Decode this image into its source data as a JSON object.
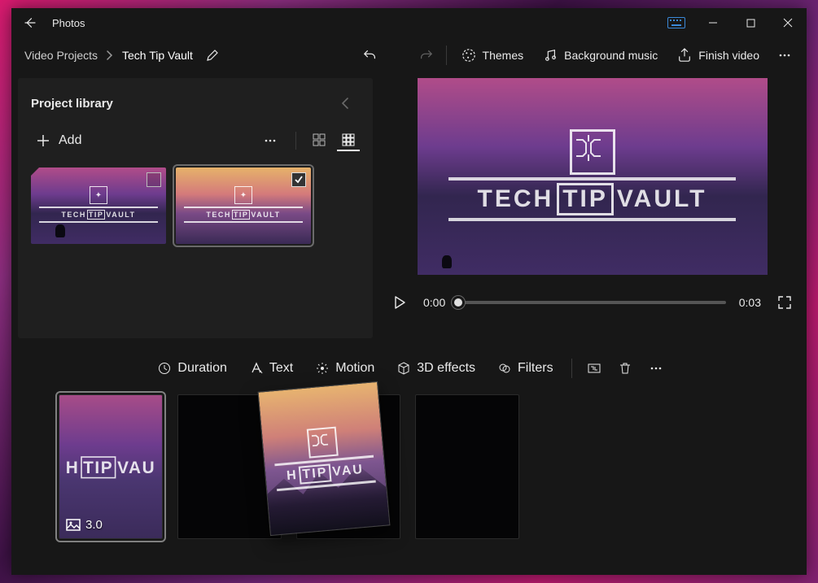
{
  "app": {
    "title": "Photos"
  },
  "breadcrumb": {
    "root": "Video Projects",
    "current": "Tech Tip Vault"
  },
  "toolbar": {
    "themes": "Themes",
    "bgmusic": "Background music",
    "finish": "Finish video"
  },
  "library": {
    "title": "Project library",
    "add": "Add",
    "items": [
      {
        "id": "night-thumb",
        "scene": "night",
        "selected": false
      },
      {
        "id": "sunset-thumb",
        "scene": "sunset",
        "selected": true
      }
    ]
  },
  "player": {
    "current": "0:00",
    "total": "0:03",
    "pos": 0
  },
  "cliptoolbar": {
    "duration": "Duration",
    "text": "Text",
    "motion": "Motion",
    "3deffects": "3D effects",
    "filters": "Filters"
  },
  "storyboard": {
    "clips": [
      {
        "duration": "3.0",
        "type": "image-night",
        "selected": true
      },
      {
        "type": "empty"
      },
      {
        "type": "empty"
      },
      {
        "type": "empty"
      }
    ],
    "dragging": {
      "type": "image-sunset"
    }
  },
  "logo": {
    "brand_a": "TECH",
    "brand_b": "TIP",
    "brand_c": "VAULT"
  }
}
